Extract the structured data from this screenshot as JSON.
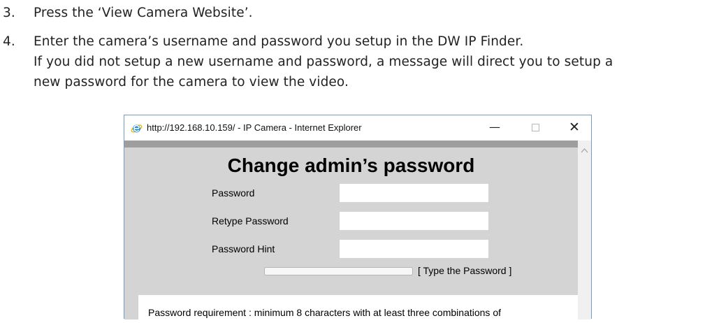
{
  "instructions": {
    "step3": {
      "number": "3.",
      "text": "Press the ‘View Camera Website’."
    },
    "step4": {
      "number": "4.",
      "lines": [
        "Enter the camera’s username and password you setup in the DW IP Finder.",
        "If you did not setup a new username and password, a message will direct you to setup a",
        "new password for the camera to view the video."
      ]
    }
  },
  "window": {
    "title": "http://192.168.10.159/ - IP Camera - Internet Explorer",
    "icon": "internet-explorer-icon",
    "minimize_glyph": "—",
    "close_glyph": "✕"
  },
  "form": {
    "heading": "Change admin’s password",
    "password_label": "Password",
    "password_value": "",
    "retype_label": "Retype Password",
    "retype_value": "",
    "hint_label": "Password Hint",
    "hint_value": "",
    "strength_text": "[ Type the Password ]",
    "strength_fraction": 0,
    "requirement_text": "Password requirement : minimum 8 characters with at least three combinations of"
  },
  "colors": {
    "content_background": "#d4d4d4",
    "window_border": "#7a9cc4",
    "ie_blue": "#1e8ad6",
    "ie_gold": "#f6b400"
  }
}
